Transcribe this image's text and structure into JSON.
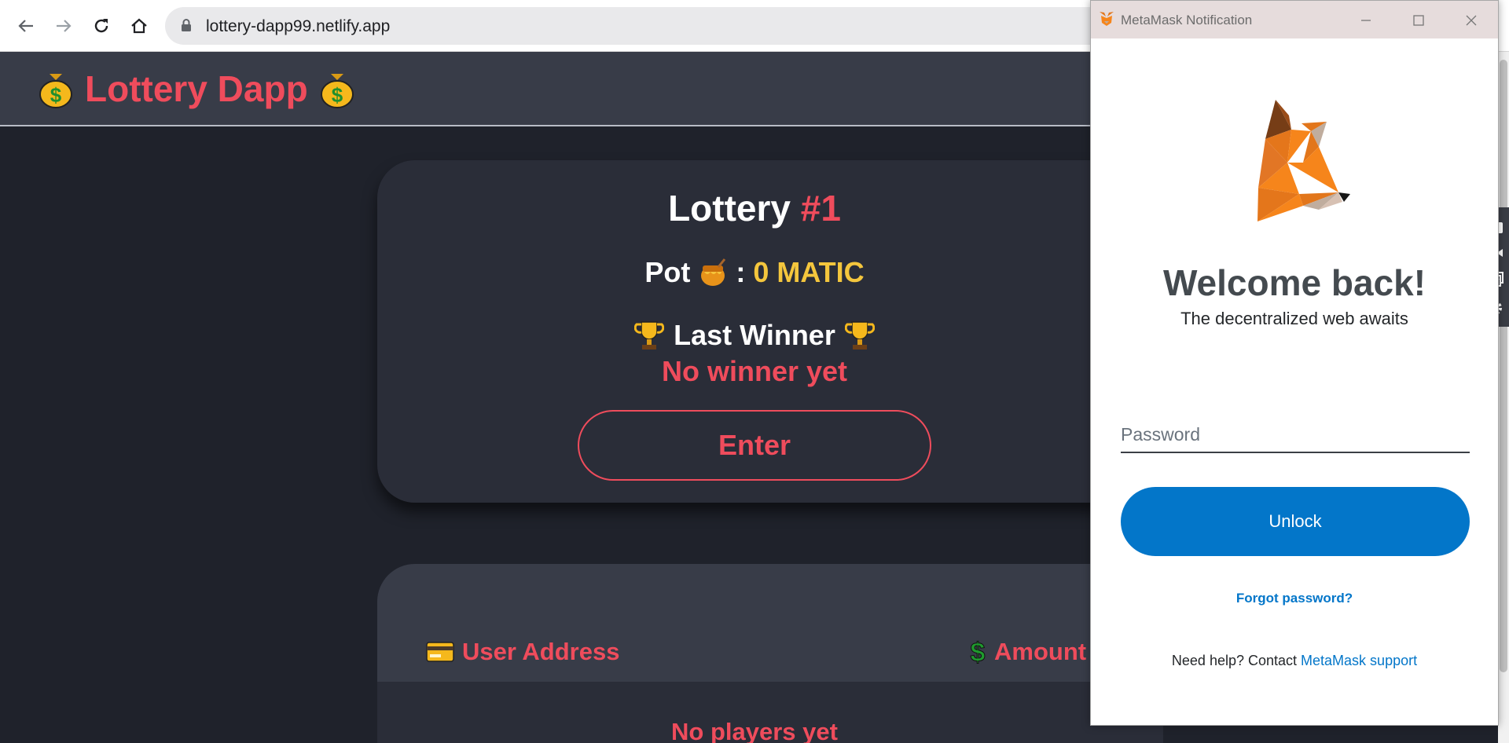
{
  "browser": {
    "url": "lottery-dapp99.netlify.app"
  },
  "app": {
    "brand_title": "Lottery Dapp",
    "lottery_label": "Lottery",
    "lottery_number": "#1",
    "pot_label": "Pot",
    "pot_separator": ":",
    "pot_value": "0 MATIC",
    "last_winner_label": "Last Winner",
    "last_winner_value": "No winner yet",
    "enter_label": "Enter",
    "table": {
      "col_address": "User Address",
      "col_amount": "Amount",
      "empty_text": "No players yet"
    }
  },
  "metamask": {
    "window_title": "MetaMask Notification",
    "welcome": "Welcome back!",
    "subtitle": "The decentralized web awaits",
    "password_placeholder": "Password",
    "unlock_label": "Unlock",
    "forgot_label": "Forgot password?",
    "help_text": "Need help? Contact",
    "help_link": "MetaMask support"
  },
  "colors": {
    "accent_red": "#ef4c5c",
    "gold": "#f4c63d",
    "metamask_blue": "#0376c9"
  }
}
